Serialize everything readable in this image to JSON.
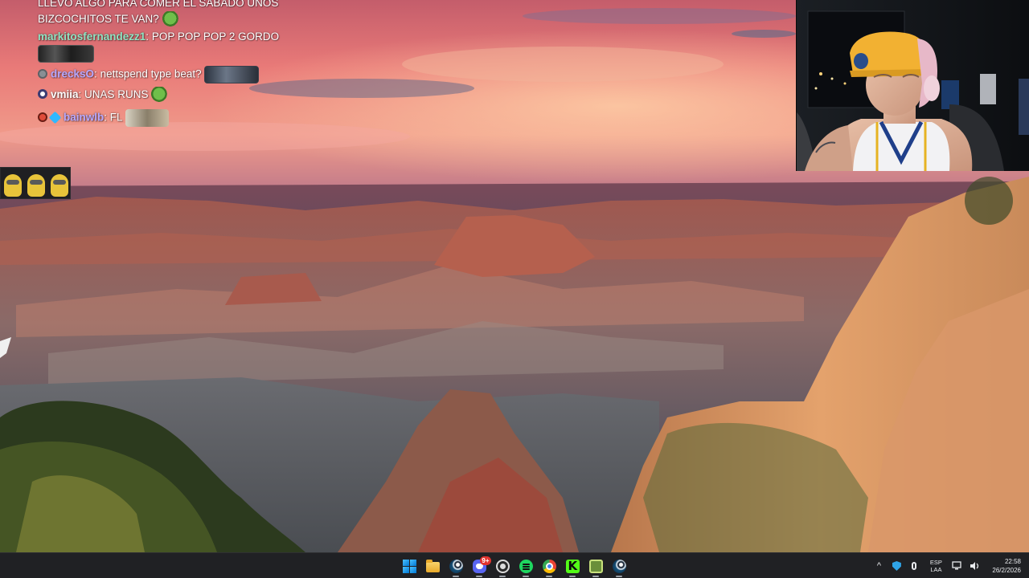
{
  "chat": {
    "messages": [
      {
        "user": "",
        "text": "LLEVO ALGO PARA COMER EL SABADO UNOS",
        "emote": ""
      },
      {
        "user": "",
        "text": "BIZCOCHITOS TE VAN?",
        "emote": "frog"
      },
      {
        "user": "markitosfernandezz1",
        "user_color": "#8fe3c2",
        "text": "POP POP POP 2 GORDO",
        "emote": ""
      },
      {
        "user": "drecksO",
        "user_color": "#b7a8ff",
        "text": "nettspend type beat?",
        "emote": "sticker"
      },
      {
        "user": "vmiia",
        "user_color": "#ffffff",
        "text": "UNAS RUNS",
        "emote": "frog"
      },
      {
        "user": "bainwlb",
        "user_color": "#b7a8ff",
        "text": "FL",
        "emote": "fl"
      }
    ]
  },
  "taskbar": {
    "apps": [
      {
        "name": "start-button",
        "icon": "windows-start-icon"
      },
      {
        "name": "file-explorer-button",
        "icon": "folder-icon"
      },
      {
        "name": "steam-button",
        "icon": "steam-icon"
      },
      {
        "name": "discord-button",
        "icon": "discord-icon",
        "badge": "9+"
      },
      {
        "name": "obs-button",
        "icon": "obs-icon"
      },
      {
        "name": "spotify-button",
        "icon": "spotify-icon"
      },
      {
        "name": "chrome-button",
        "icon": "chrome-icon"
      },
      {
        "name": "kick-button",
        "icon": "kick-icon"
      },
      {
        "name": "game-button",
        "icon": "game-icon"
      },
      {
        "name": "steam-button-2",
        "icon": "steam-icon"
      }
    ],
    "tray": {
      "chevron": "^",
      "lang_line1": "ESP",
      "lang_line2": "LAA",
      "time": "22:58",
      "date": "26/2/2026"
    }
  },
  "colors": {
    "taskbar_bg": "#202124",
    "chat_text": "#ffffff",
    "discord_badge": "#e3342f"
  }
}
